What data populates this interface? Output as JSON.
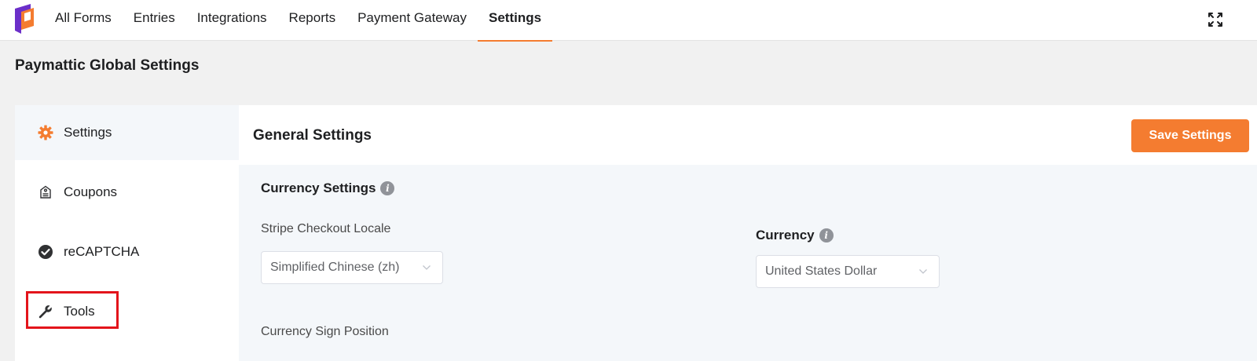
{
  "nav": {
    "items": [
      {
        "label": "All Forms"
      },
      {
        "label": "Entries"
      },
      {
        "label": "Integrations"
      },
      {
        "label": "Reports"
      },
      {
        "label": "Payment Gateway"
      },
      {
        "label": "Settings"
      }
    ],
    "active": "Settings"
  },
  "page": {
    "title": "Paymattic Global Settings"
  },
  "sidebar": {
    "items": [
      {
        "label": "Settings",
        "icon": "gear-icon"
      },
      {
        "label": "Coupons",
        "icon": "coupon-tag-icon"
      },
      {
        "label": "reCAPTCHA",
        "icon": "check-circle-icon"
      },
      {
        "label": "Tools",
        "icon": "wrench-icon"
      }
    ]
  },
  "main": {
    "title": "General Settings",
    "save_label": "Save Settings",
    "currency_section": {
      "title": "Currency Settings",
      "locale_label": "Stripe Checkout Locale",
      "locale_value": "Simplified Chinese (zh)",
      "currency_label": "Currency",
      "currency_value": "United States Dollar",
      "sign_position_label": "Currency Sign Position"
    }
  },
  "colors": {
    "accent": "#f47c30",
    "highlight": "#e3141b",
    "panel_bg": "#f4f7fa",
    "page_bg": "#f1f1f1"
  }
}
